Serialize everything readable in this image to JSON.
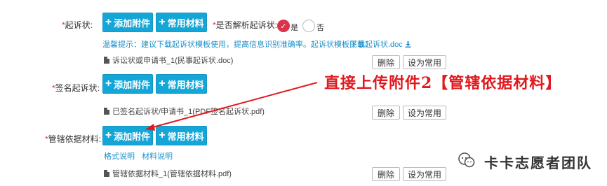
{
  "rows": [
    {
      "label": "起诉状:",
      "add_button": "添加附件",
      "common_button": "常用材料",
      "parse_question": "是否解析起诉状:",
      "radio_yes": "是",
      "radio_no": "否",
      "hint": "温馨提示：建议下载起诉状模板使用，提高信息识别准确率。起诉状模板下载：",
      "template_link": "民事起诉状.doc",
      "file_name": "诉讼状或申请书_1(民事起诉状.doc)",
      "delete_button": "删除",
      "set_common_button": "设为常用"
    },
    {
      "label": "签名起诉状:",
      "add_button": "添加附件",
      "common_button": "常用材料",
      "file_name": "已签名起诉状/申请书_1(PDF签名起诉状.pdf)",
      "delete_button": "删除",
      "set_common_button": "设为常用"
    },
    {
      "label": "管辖依据材料:",
      "add_button": "添加附件",
      "common_button": "常用材料",
      "format_link": "格式说明",
      "material_link": "材料说明",
      "file_name": "管辖依据材料_1(管辖依据材料.pdf)",
      "delete_button": "删除",
      "set_common_button": "设为常用"
    }
  ],
  "annotation": "直接上传附件2【管辖依据材料】",
  "watermark": "卡卡志愿者团队",
  "colors": {
    "button_cyan": "#15a6d8",
    "radio_checked": "#d9344a",
    "hint_blue": "#1a8fc9",
    "annotation_red": "#e0191e"
  }
}
